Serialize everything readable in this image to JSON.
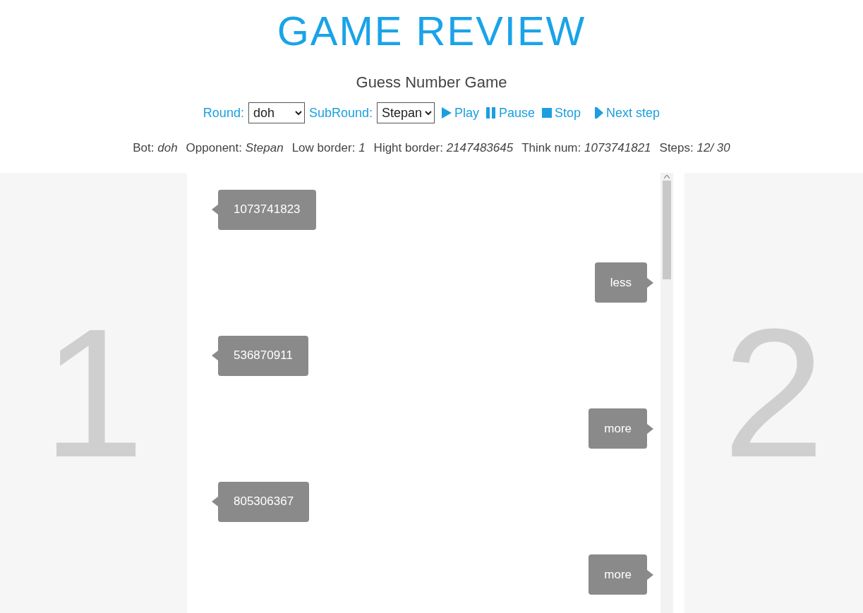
{
  "title": "GAME REVIEW",
  "subtitle": "Guess Number Game",
  "controls": {
    "round_label": "Round:",
    "round_value": "doh",
    "subround_label": "SubRound:",
    "subround_value": "Stepan",
    "buttons": [
      {
        "kind": "play",
        "label": "Play"
      },
      {
        "kind": "pause",
        "label": "Pause"
      },
      {
        "kind": "stop",
        "label": "Stop"
      },
      {
        "kind": "next",
        "label": "Next step"
      }
    ]
  },
  "info": [
    {
      "label": "Bot:",
      "value": "doh"
    },
    {
      "label": "Opponent:",
      "value": "Stepan"
    },
    {
      "label": "Low border:",
      "value": "1"
    },
    {
      "label": "Hight border:",
      "value": "2147483645"
    },
    {
      "label": "Think num:",
      "value": "1073741821"
    },
    {
      "label": "Steps:",
      "value": "12/ 30"
    }
  ],
  "players": [
    "1",
    "2"
  ],
  "messages": [
    {
      "kind": "guess",
      "text": "1073741823"
    },
    {
      "kind": "reply",
      "text": "less"
    },
    {
      "kind": "guess",
      "text": "536870911"
    },
    {
      "kind": "reply",
      "text": "more"
    },
    {
      "kind": "guess",
      "text": "805306367"
    },
    {
      "kind": "reply",
      "text": "more"
    }
  ]
}
